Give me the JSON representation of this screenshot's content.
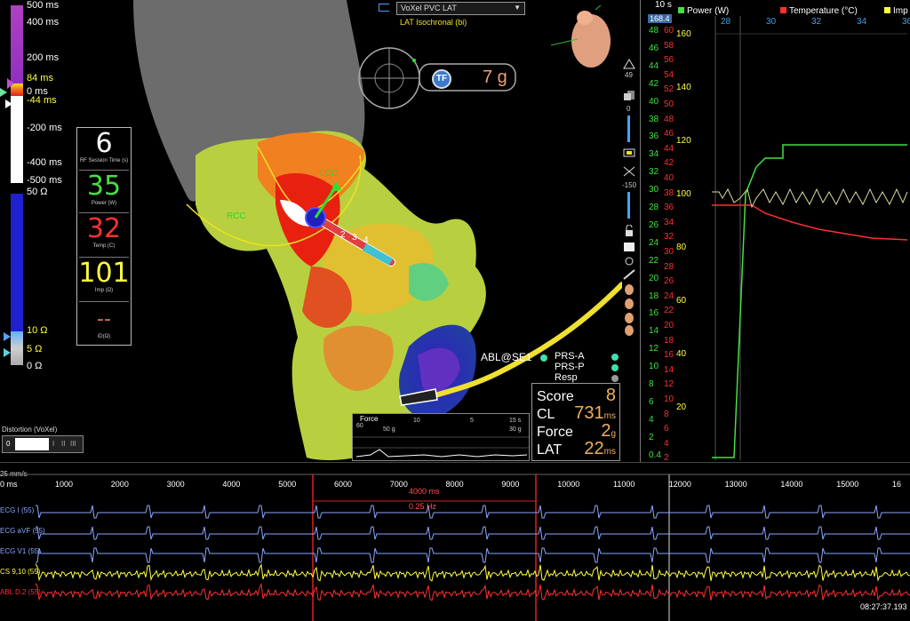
{
  "left_scale": {
    "labels": [
      "500 ms",
      "400 ms",
      "200 ms",
      "84 ms",
      "0 ms",
      "-44 ms",
      "-200 ms",
      "-400 ms",
      "-500 ms",
      "50 Ω",
      "10 Ω",
      "5 Ω",
      "0 Ω"
    ]
  },
  "metrics": [
    {
      "value": "6",
      "caption": "RF Session Time (s)",
      "color": "#ffffff"
    },
    {
      "value": "35",
      "caption": "Power (W)",
      "color": "#44e044"
    },
    {
      "value": "32",
      "caption": "Temp (C)",
      "color": "#ff3030"
    },
    {
      "value": "101",
      "caption": "Imp (Ω)",
      "color": "#ffff40"
    },
    {
      "value": "--",
      "caption": "iD(Ω)",
      "color": "#e07060"
    }
  ],
  "map": {
    "dropdown_value": "VoXel PVC LAT",
    "map_type": "LAT Isochronal (bi)",
    "force_value": "7 g",
    "tf_badge": "TF",
    "labels": {
      "rcc": "RCC",
      "lcc": "LCC"
    },
    "electrodes": [
      "2",
      "3",
      "4"
    ],
    "catheter_labels": {
      "abl": "ABL@SE1",
      "prs_a": "PRS-A",
      "prs_p": "PRS-P",
      "resp": "Resp"
    }
  },
  "force_chart": {
    "title": "Force",
    "ticks": [
      "10",
      "5",
      "15 s"
    ],
    "y1": "60",
    "y2": "50 g",
    "y3": "30 g"
  },
  "distortion": {
    "title": "Distortion (VoXel)",
    "scale": [
      "0",
      "I",
      "II",
      "III"
    ]
  },
  "score_panel": [
    {
      "label": "Score",
      "value": "8",
      "unit": ""
    },
    {
      "label": "CL",
      "value": "731",
      "unit": "ms"
    },
    {
      "label": "Force",
      "value": "2",
      "unit": "g"
    },
    {
      "label": "LAT",
      "value": "22",
      "unit": "ms"
    }
  ],
  "side_icons": {
    "zoom_value": "49",
    "slider1": "0",
    "slider2": "-150"
  },
  "trend": {
    "header": "10 s",
    "readout": "168.4",
    "legend": [
      {
        "name": "Power (W)",
        "color": "#44e044"
      },
      {
        "name": "Temperature (°C)",
        "color": "#ff3030"
      },
      {
        "name": "Imp",
        "color": "#ffff40"
      }
    ],
    "top_axis": [
      "28",
      "30",
      "32",
      "34",
      "36"
    ],
    "power_axis": [
      "48",
      "46",
      "44",
      "42",
      "40",
      "38",
      "36",
      "34",
      "32",
      "30",
      "28",
      "26",
      "24",
      "22",
      "20",
      "18",
      "16",
      "14",
      "12",
      "10",
      "8",
      "6",
      "4",
      "2",
      "0.4"
    ],
    "temp_axis": [
      "60",
      "58",
      "56",
      "54",
      "52",
      "50",
      "48",
      "46",
      "44",
      "42",
      "40",
      "38",
      "36",
      "34",
      "32",
      "30",
      "28",
      "26",
      "24",
      "22",
      "20",
      "18",
      "16",
      "14",
      "12",
      "10",
      "8",
      "6",
      "4",
      "2"
    ],
    "imp_axis": [
      "160",
      "140",
      "120",
      "100",
      "80",
      "60",
      "40",
      "20"
    ]
  },
  "bottom": {
    "speed": "25 mm/s",
    "ms_label": "0 ms",
    "ticks": [
      "1000",
      "2000",
      "3000",
      "4000",
      "5000",
      "6000",
      "7000",
      "8000",
      "9000",
      "10000",
      "11000",
      "12000",
      "13000",
      "14000",
      "15000",
      "16"
    ],
    "caliper": {
      "interval": "4000 ms",
      "freq": "0.25 Hz"
    },
    "channels": [
      {
        "name": "ECG I (55)",
        "color": "#8aa8ff"
      },
      {
        "name": "ECG aVF (55)",
        "color": "#8aa8ff"
      },
      {
        "name": "ECG V1 (55)",
        "color": "#8aa8ff"
      },
      {
        "name": "CS 9,10 (55)",
        "color": "#ffff40"
      },
      {
        "name": "ABL D,2 (55)",
        "color": "#ff3030"
      }
    ],
    "clock": "08:27:37.193"
  },
  "colors": {
    "accent": "#40c0ff",
    "power": "#44e044",
    "temp": "#ff3030",
    "imp": "#ffff40",
    "score": "#f0b060"
  }
}
